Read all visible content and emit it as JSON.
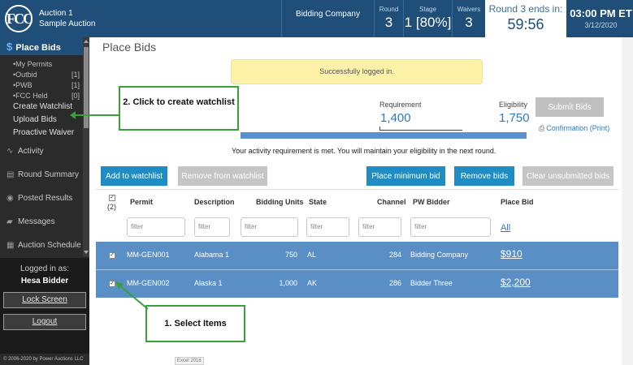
{
  "header": {
    "logo": "FCC",
    "auction_line1": "Auction 1",
    "auction_line2": "Sample Auction",
    "company": "Bidding Company",
    "round_label": "Round",
    "round_value": "3",
    "stage_label": "Stage",
    "stage_value": "1 [80%]",
    "waivers_label": "Waivers",
    "waivers_value": "3",
    "timer_label": "Round 3 ends in:",
    "timer_value": "59:56",
    "clock_time": "03:00 PM ET",
    "clock_date": "3/12/2020"
  },
  "sidebar": {
    "active": {
      "icon": "$",
      "label": "Place Bids"
    },
    "sub_items": [
      {
        "label": "My Permits",
        "count": ""
      },
      {
        "label": "Outbid",
        "count": "[1]"
      },
      {
        "label": "PWB",
        "count": "[1]"
      },
      {
        "label": "FCC Held",
        "count": "[0]"
      }
    ],
    "links": [
      "Create Watchlist",
      "Upload Bids",
      "Proactive Waiver"
    ],
    "nav": [
      {
        "icon": "activity-icon",
        "label": "Activity"
      },
      {
        "icon": "round-summary-icon",
        "label": "Round Summary"
      },
      {
        "icon": "posted-results-icon",
        "label": "Posted Results"
      },
      {
        "icon": "messages-icon",
        "label": "Messages"
      },
      {
        "icon": "auction-schedule-icon",
        "label": "Auction Schedule"
      }
    ],
    "logged_in_label": "Logged in as:",
    "user": "Hesa Bidder",
    "lock_screen": "Lock Screen",
    "logout": "Logout",
    "copyright": "© 2006-2020 by Power Auctions LLC"
  },
  "main": {
    "title": "Place Bids",
    "alert": "Successfully logged in.",
    "requirement_label": "Requirement",
    "requirement_value": "1,400",
    "eligibility_label": "Eligibility",
    "eligibility_value": "1,750",
    "eligibility_fill": 1.0,
    "submit_bids": "Submit Bids",
    "confirmation": "Confirmation",
    "print": "(Print)",
    "activity_message": "Your activity requirement is met. You will maintain your eligibility in the next round.",
    "buttons": {
      "add_watchlist": "Add to watchlist",
      "remove_watchlist": "Remove from watchlist",
      "place_min_bid": "Place minimum bid",
      "remove_bids": "Remove bids",
      "clear_unsubmitted": "Clear unsubmitted bids"
    },
    "table": {
      "select_count": "(2)",
      "headers": [
        "Permit",
        "Description",
        "Bidding Units",
        "State",
        "Channel",
        "PW Bidder",
        "Place Bid"
      ],
      "filter_placeholder": "filter",
      "all_link": "All",
      "rows": [
        {
          "permit": "MM-GEN001",
          "description": "Alabama 1",
          "units": "750",
          "state": "AL",
          "channel": "284",
          "pw_bidder": "Bidding Company",
          "bid": "$910"
        },
        {
          "permit": "MM-GEN002",
          "description": "Alaska 1",
          "units": "1,000",
          "state": "AK",
          "channel": "286",
          "pw_bidder": "Bidder Three",
          "bid": "$2,200"
        }
      ]
    },
    "excel_tag": "Excel 2016"
  },
  "callouts": {
    "create_watchlist": "2.  Click to create watchlist",
    "select_items": "1.  Select Items"
  },
  "colors": {
    "header": "#1f4e79",
    "sidebar": "#2b2b2b",
    "row_selected": "#5a8fc6",
    "button_blue": "#1f8dc3",
    "callout_green": "#3aa03a",
    "alert_yellow": "#fdf2a8"
  }
}
